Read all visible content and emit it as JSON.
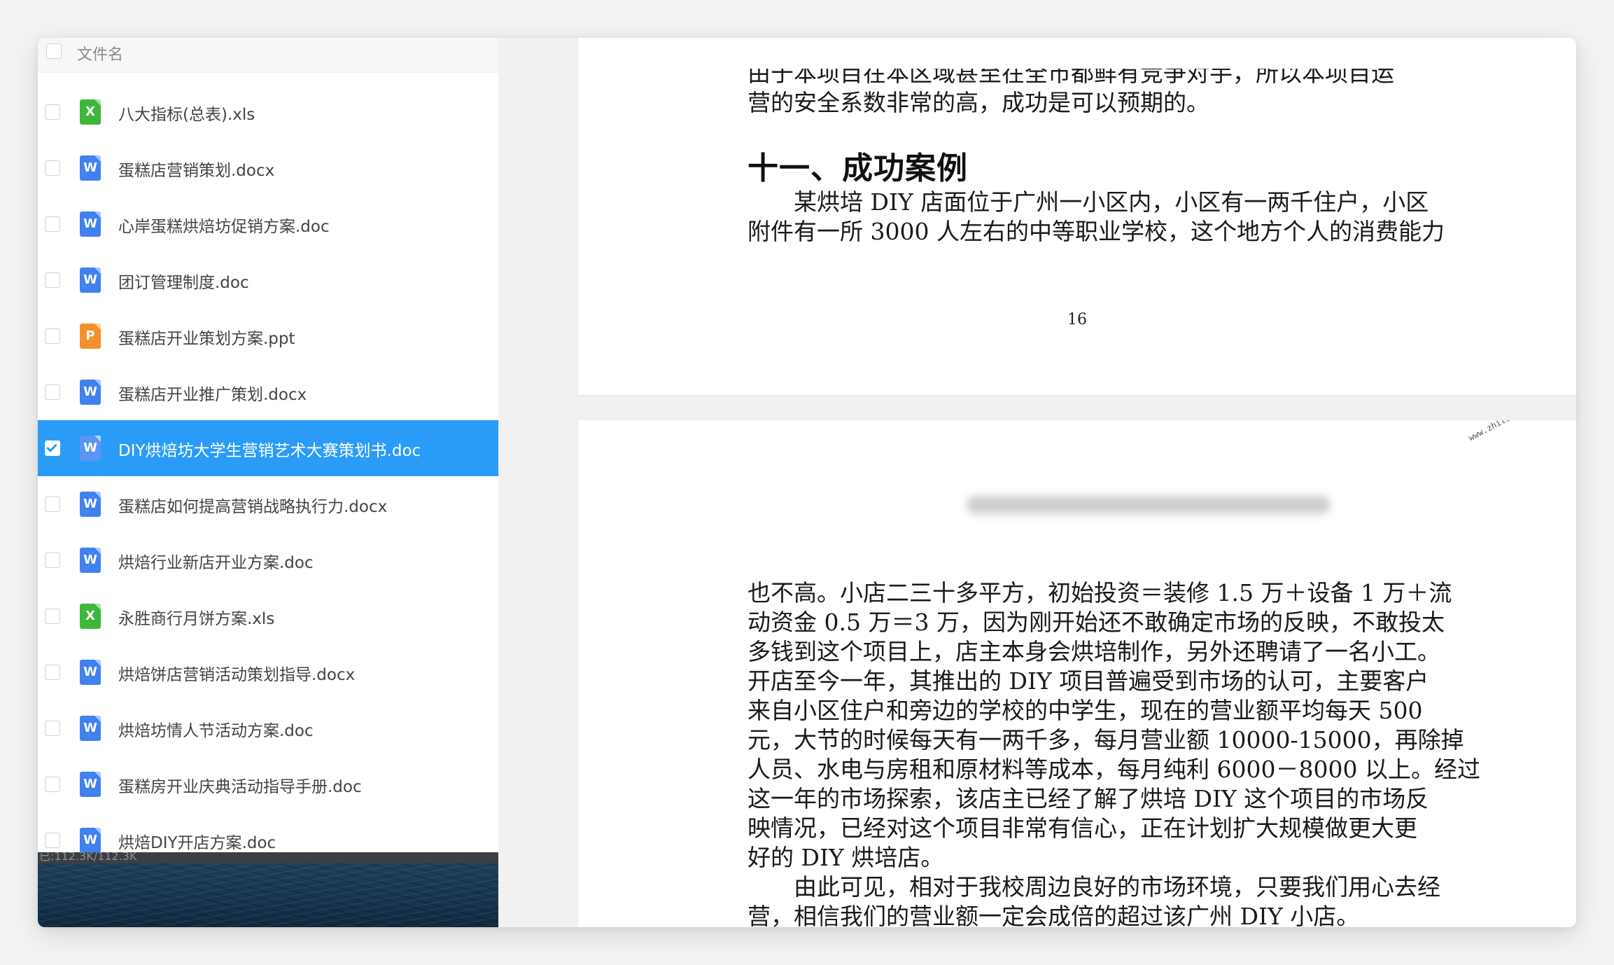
{
  "file_list": {
    "header": {
      "label": "文件名"
    },
    "files": [
      {
        "name": "八大指标(总表).xls",
        "icon": "X",
        "type": "excel-icon",
        "selected": false
      },
      {
        "name": "蛋糕店营销策划.docx",
        "icon": "W",
        "type": "word-icon",
        "selected": false
      },
      {
        "name": "心岸蛋糕烘焙坊促销方案.doc",
        "icon": "W",
        "type": "word-icon",
        "selected": false
      },
      {
        "name": "团订管理制度.doc",
        "icon": "W",
        "type": "word-icon",
        "selected": false
      },
      {
        "name": "蛋糕店开业策划方案.ppt",
        "icon": "P",
        "type": "powerpoint-icon",
        "selected": false
      },
      {
        "name": "蛋糕店开业推广策划.docx",
        "icon": "W",
        "type": "word-icon",
        "selected": false
      },
      {
        "name": "DIY烘焙坊大学生营销艺术大赛策划书.doc",
        "icon": "W",
        "type": "word-icon",
        "selected": true
      },
      {
        "name": "蛋糕店如何提高营销战略执行力.docx",
        "icon": "W",
        "type": "word-icon",
        "selected": false
      },
      {
        "name": "烘焙行业新店开业方案.doc",
        "icon": "W",
        "type": "word-icon",
        "selected": false
      },
      {
        "name": "永胜商行月饼方案.xls",
        "icon": "X",
        "type": "excel-icon",
        "selected": false
      },
      {
        "name": "烘焙饼店营销活动策划指导.docx",
        "icon": "W",
        "type": "word-icon",
        "selected": false
      },
      {
        "name": "烘焙坊情人节活动方案.doc",
        "icon": "W",
        "type": "word-icon",
        "selected": false
      },
      {
        "name": "蛋糕房开业庆典活动指导手册.doc",
        "icon": "W",
        "type": "word-icon",
        "selected": false
      },
      {
        "name": "烘焙DIY开店方案.doc",
        "icon": "W",
        "type": "word-icon",
        "selected": false
      }
    ],
    "status_text": "已:112.3K/112.3K"
  },
  "document": {
    "page1": {
      "para_top": [
        "由于本项目在本区域甚至在全市都鲜有竞争对手，所以本项目运",
        "营的安全系数非常的高，成功是可以预期的。"
      ],
      "heading": "十一、成功案例",
      "para_case": [
        "　　某烘培 DIY 店面位于广州一小区内，小区有一两千住户，小区",
        "附件有一所 3000 人左右的中等职业学校，这个地方个人的消费能力"
      ],
      "page_number": "16"
    },
    "page2": {
      "watermark": "www.zhilihuijia ▓▓▓▓▓",
      "para_main": [
        "也不高。小店二三十多平方，初始投资＝装修 1.5 万＋设备 1 万＋流",
        "动资金 0.5 万＝3 万，因为刚开始还不敢确定市场的反映，不敢投太",
        "多钱到这个项目上，店主本身会烘培制作，另外还聘请了一名小工。",
        "开店至今一年，其推出的 DIY 项目普遍受到市场的认可，主要客户",
        "来自小区住户和旁边的学校的中学生，现在的营业额平均每天 500",
        "元，大节的时候每天有一两千多，每月营业额 10000-15000，再除掉",
        "人员、水电与房租和原材料等成本，每月纯利 6000－8000 以上。经过",
        "这一年的市场探索，该店主已经了解了烘培 DIY 这个项目的市场反",
        "映情况，已经对这个项目非常有信心，正在计划扩大规模做更大更",
        "好的 DIY 烘培店。"
      ],
      "para_end": [
        "　　由此可见，相对于我校周边良好的市场环境，只要我们用心去经",
        "营，相信我们的营业额一定会成倍的超过该广州 DIY 小店。"
      ]
    }
  },
  "colors": {
    "selection": "#2a9cf7",
    "word": "#3f82f0",
    "excel": "#3db83b",
    "powerpoint": "#f2912c"
  }
}
